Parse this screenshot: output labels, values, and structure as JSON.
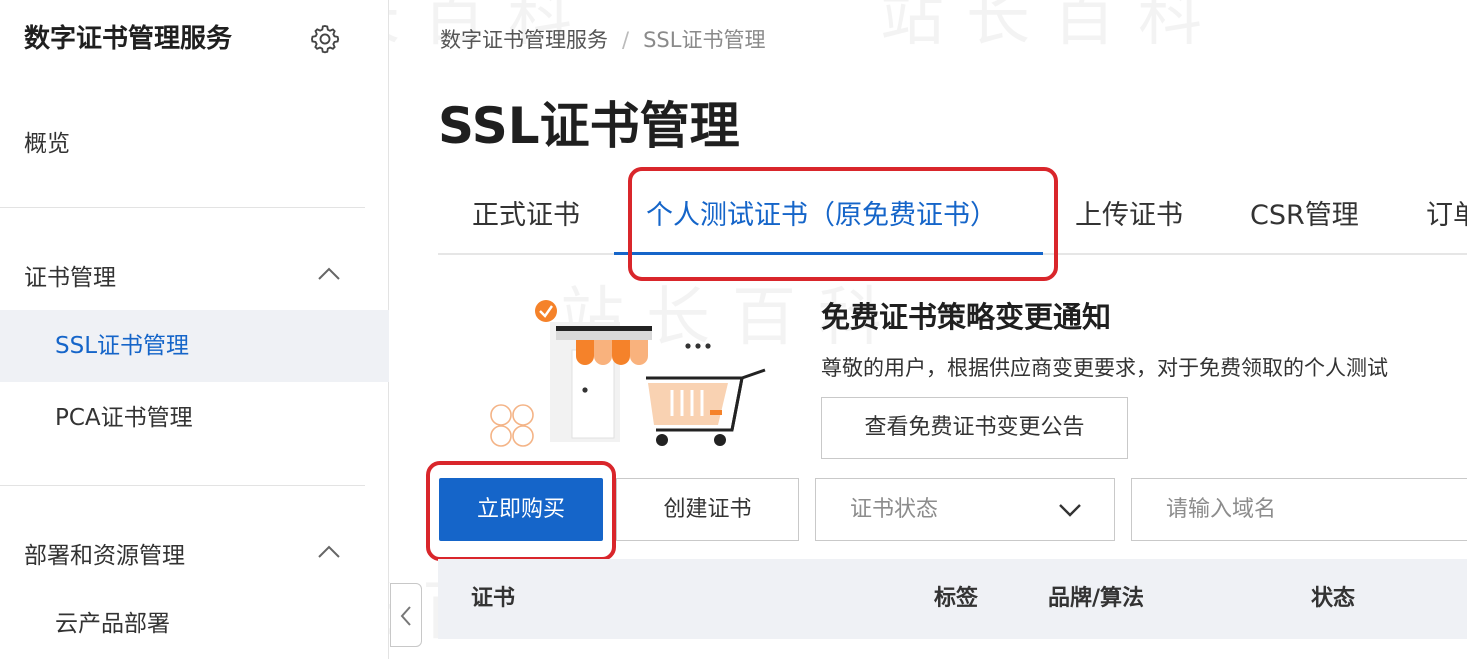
{
  "sidebar": {
    "title": "数字证书管理服务",
    "overview": "概览",
    "groups": [
      {
        "label": "证书管理",
        "items": [
          "SSL证书管理",
          "PCA证书管理"
        ]
      },
      {
        "label": "部署和资源管理",
        "items": [
          "云产品部署"
        ]
      }
    ]
  },
  "breadcrumb": [
    "数字证书管理服务",
    "/",
    "SSL证书管理"
  ],
  "page_title": "SSL证书管理",
  "tabs": [
    "正式证书",
    "个人测试证书（原免费证书）",
    "上传证书",
    "CSR管理",
    "订单"
  ],
  "notice": {
    "title": "免费证书策略变更通知",
    "text": "尊敬的用户，根据供应商变更要求，对于免费领取的个人测试",
    "button": "查看免费证书变更公告"
  },
  "toolbar": {
    "buy": "立即购买",
    "create": "创建证书",
    "status_select": "证书状态",
    "search_placeholder": "请输入域名"
  },
  "table": {
    "columns": [
      "证书",
      "标签",
      "品牌/算法",
      "状态"
    ]
  },
  "watermark": "站长百科",
  "colors": {
    "accent": "#1565c9",
    "highlight": "#d9262b",
    "illustration_orange": "#f5822a"
  }
}
